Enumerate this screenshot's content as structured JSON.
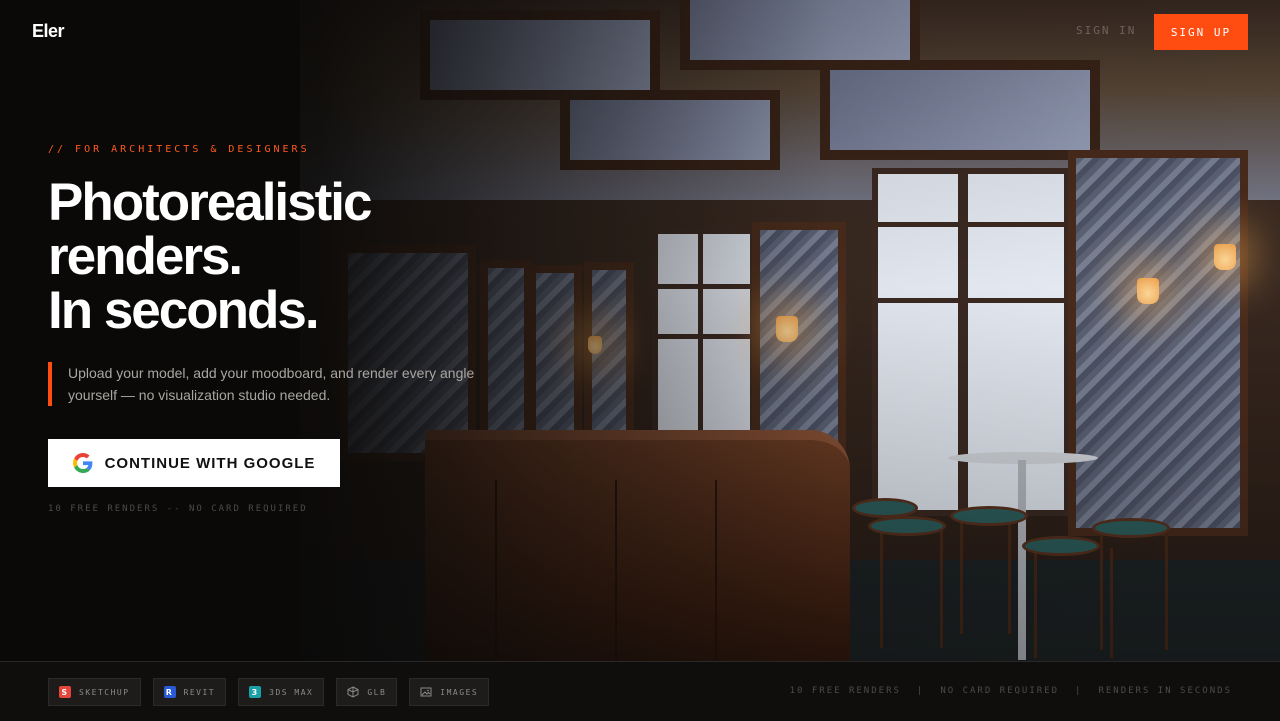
{
  "nav": {
    "logo": "Eler",
    "sign_in": "SIGN IN",
    "sign_up": "SIGN UP"
  },
  "hero": {
    "eyebrow": "// FOR ARCHITECTS & DESIGNERS",
    "headline": [
      "Photorealistic",
      "renders.",
      "In seconds."
    ],
    "subtext": "Upload your model, add your moodboard, and render every angle yourself — no visualization studio needed.",
    "cta_label": "CONTINUE WITH GOOGLE",
    "cta_icon": "google-logo-icon",
    "note": "10 FREE RENDERS -- NO CARD REQUIRED"
  },
  "footer": {
    "formats": [
      {
        "label": "SKETCHUP",
        "icon": "sketchup-icon",
        "color": "#e4463c"
      },
      {
        "label": "REVIT",
        "icon": "revit-icon",
        "color": "#2a5ad6"
      },
      {
        "label": "3DS MAX",
        "icon": "3ds-max-icon",
        "color": "#1aa0a8"
      },
      {
        "label": "GLB",
        "icon": "cube-icon",
        "color": "#8b8985"
      },
      {
        "label": "IMAGES",
        "icon": "image-icon",
        "color": "#8b8985"
      }
    ],
    "stats": [
      "10 FREE RENDERS",
      "|",
      "NO CARD REQUIRED",
      "|",
      "RENDERS IN SECONDS"
    ]
  },
  "colors": {
    "accent": "#ff4d12",
    "background": "#0d0c0b"
  }
}
